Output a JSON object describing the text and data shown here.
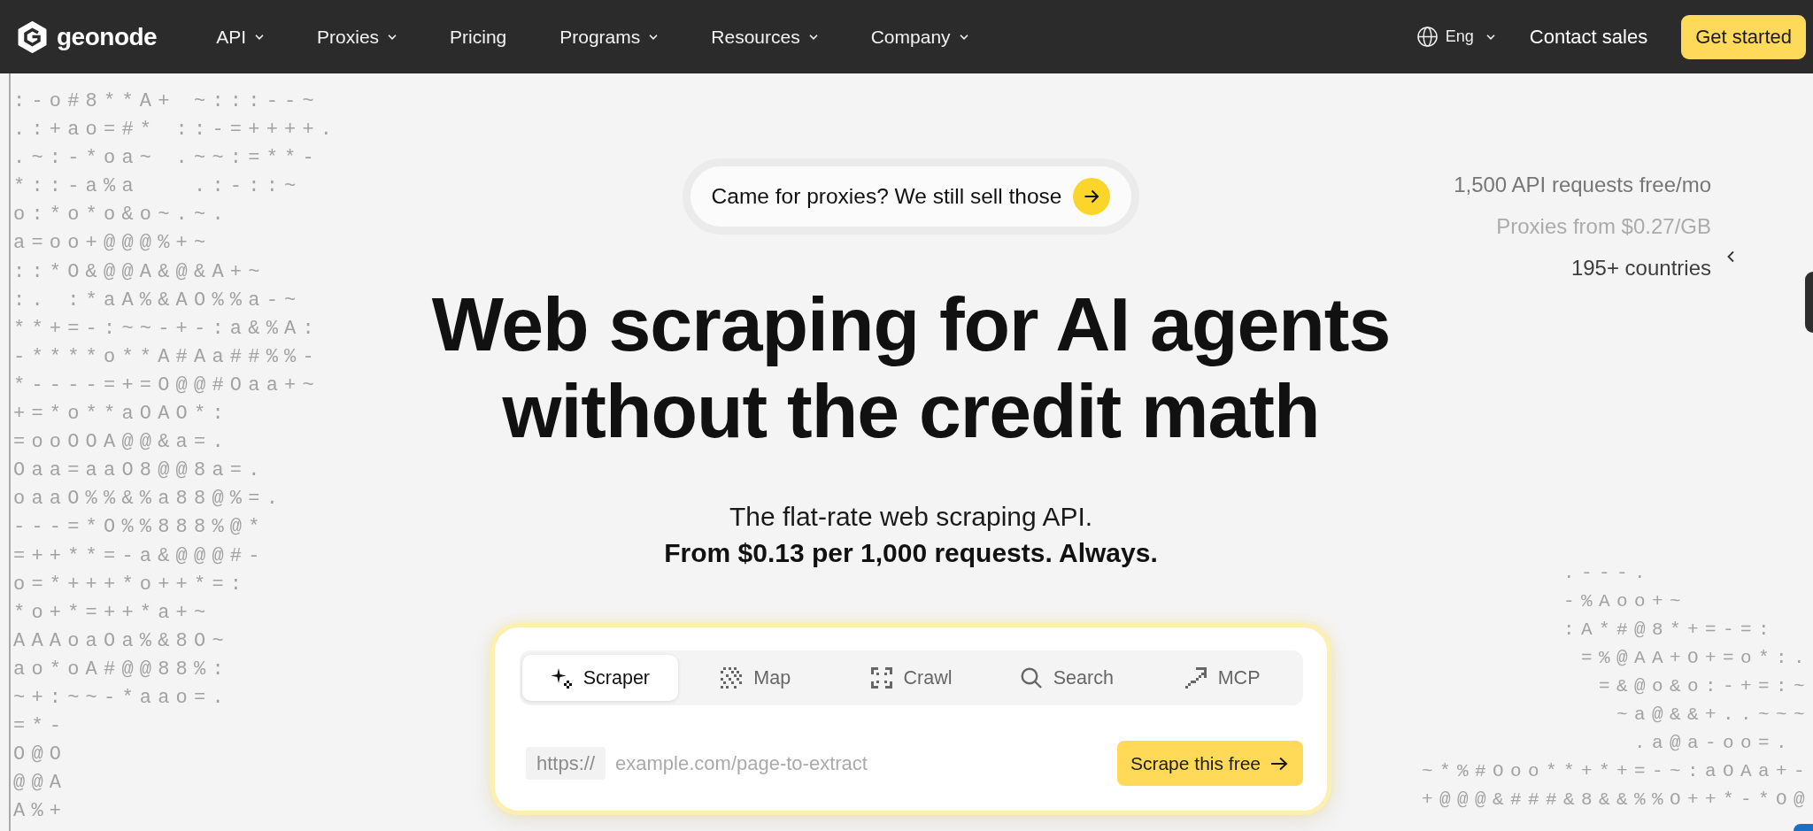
{
  "nav": {
    "logo": "geonode",
    "links": [
      {
        "label": "API",
        "dropdown": true
      },
      {
        "label": "Proxies",
        "dropdown": true
      },
      {
        "label": "Pricing",
        "dropdown": false
      },
      {
        "label": "Programs",
        "dropdown": true
      },
      {
        "label": "Resources",
        "dropdown": true
      },
      {
        "label": "Company",
        "dropdown": true
      }
    ],
    "language": "Eng",
    "contact": "Contact sales",
    "cta": "Get started"
  },
  "ascii_art": {
    "left": [
      ":-o#8**A+ ~:::--~",
      ".:+ao=#* ::-=++++.",
      ".~:-*oa~ .~~:=**-",
      "*::-a%a   .:-::~",
      "o:*o*o&o~.~.",
      "a=oo+@@@%+~",
      "::*O&@@A&@&A+~",
      ":. :*aA%&AO%%a-~",
      "**+=-:~~-+-:a&%A:",
      "-****o**A#Aa##%%-",
      "*----=+=O@@#Oaa+~",
      "+=*o**aOAO*:",
      "=ooOOA@@&a=.",
      "Oaa=aaO8@@8a=.",
      "oaaO%%&%a88@%=.",
      "---=*O%%888%@*",
      "=++**=-a&@@@#-",
      "o=*+++*o++*=:",
      "*o+*=++*a+~",
      "AAAoaOa%&8O~",
      "ao*oA#@@88%:",
      "~+:~~-*aao=.",
      "=*-",
      "O@O",
      "@@A",
      "A%+"
    ],
    "right": [
      ".---.",
      "-%Aoo+~",
      ":A*#@8*+=-=:",
      "=%@AA+O+=o*:.",
      "=&@o&o:-+=:~",
      "~a@&&+..~~~",
      ".a@a-oo=.",
      "~*%#Ooo**+*+=-~:aOAa+-",
      "+@@@&###&8&&%%O++*-*O@"
    ]
  },
  "announcement": "Came for proxies? We still sell those",
  "headline": "Web scraping for AI agents without the credit math",
  "subtitle": "The flat-rate web scraping API.",
  "price_line": "From $0.13 per 1,000 requests. Always.",
  "stats": [
    {
      "text": "1,500 API requests free/mo",
      "color": "#767676"
    },
    {
      "text": "Proxies from $0.27/GB",
      "color": "#ababab"
    },
    {
      "text": "195+ countries",
      "color": "#3d3d3d"
    }
  ],
  "scraper": {
    "tabs": [
      {
        "label": "Scraper",
        "selected": true
      },
      {
        "label": "Map",
        "selected": false
      },
      {
        "label": "Crawl",
        "selected": false
      },
      {
        "label": "Search",
        "selected": false
      },
      {
        "label": "MCP",
        "selected": false
      }
    ],
    "url_prefix": "https://",
    "placeholder": "example.com/page-to-extract",
    "button": "Scrape this free"
  }
}
